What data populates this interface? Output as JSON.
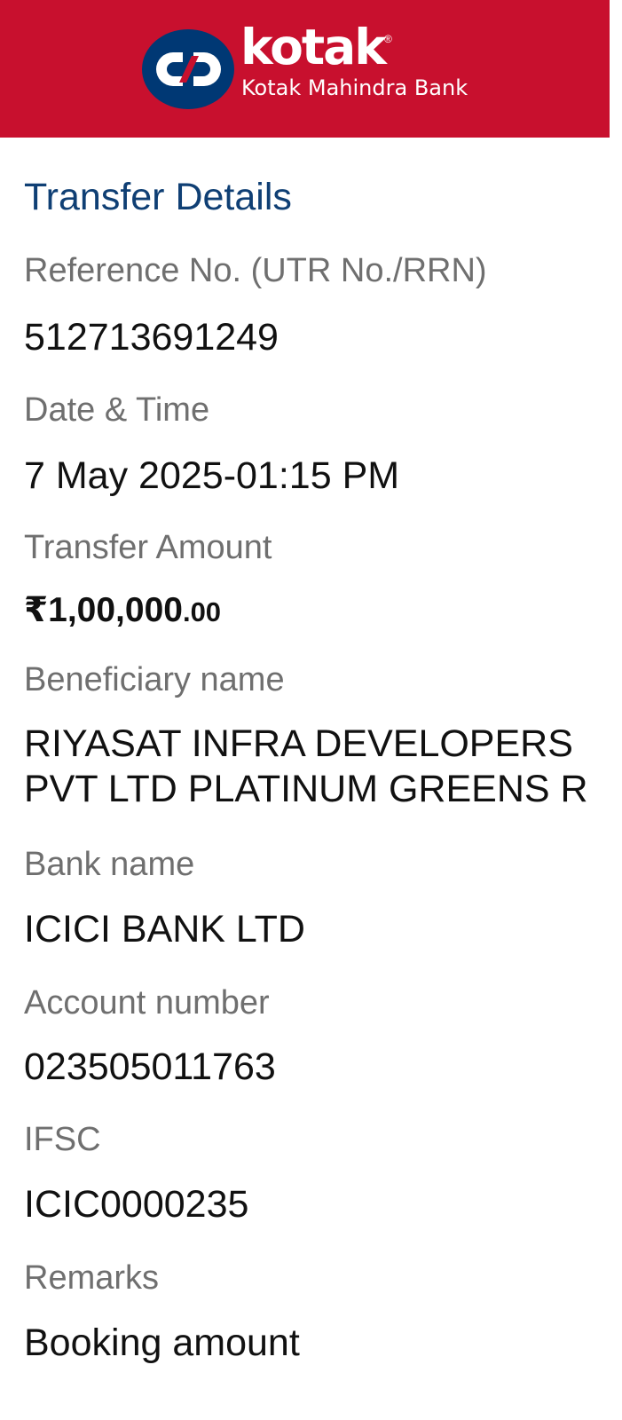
{
  "header": {
    "background_color": "#c8102e",
    "logo": {
      "brand_name": "kotak",
      "registered_mark": "®",
      "bank_name": "Kotak Mahindra Bank",
      "icon": "kotak-logo-icon"
    }
  },
  "transfer_details": {
    "title": "Transfer Details",
    "title_color": "#0f3f74",
    "fields": {
      "reference": {
        "label": "Reference No. (UTR No./RRN)",
        "value": "512713691249"
      },
      "date_time": {
        "label": "Date & Time",
        "value": "7 May 2025-01:15 PM"
      },
      "amount": {
        "label": "Transfer Amount",
        "value_main": "₹1,00,000",
        "value_paise": ".00"
      },
      "beneficiary": {
        "label": "Beneficiary name",
        "value": "RIYASAT INFRA DEVELOPERS PVT LTD PLATINUM GREENS R"
      },
      "bank": {
        "label": "Bank name",
        "value": "ICICI BANK LTD"
      },
      "account": {
        "label": "Account number",
        "value": "023505011763"
      },
      "ifsc": {
        "label": "IFSC",
        "value": "ICIC0000235"
      },
      "remarks": {
        "label": "Remarks",
        "value": "Booking amount"
      }
    }
  }
}
